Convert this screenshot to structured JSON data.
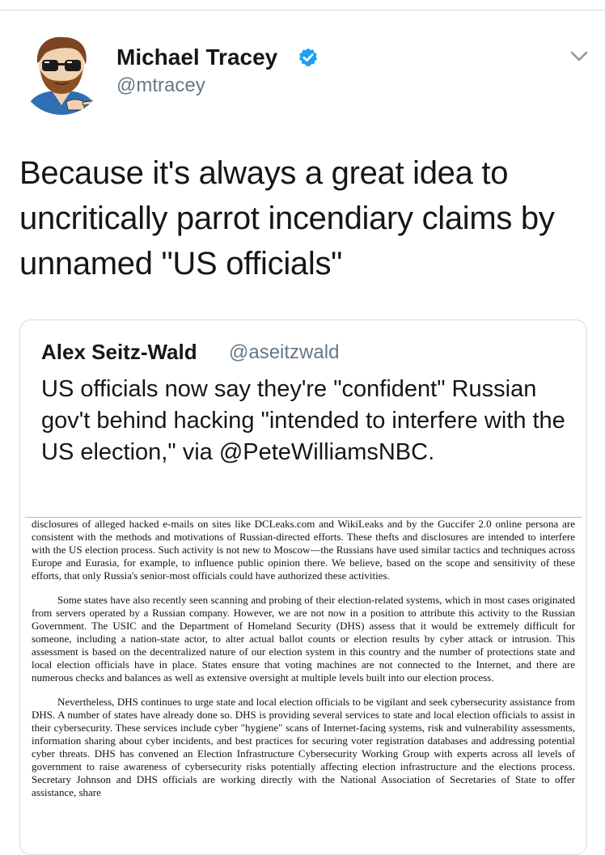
{
  "author": {
    "name": "Michael Tracey",
    "handle": "@mtracey",
    "avatar_icon": "cartoon-avatar-icon",
    "verified_icon": "verified-badge-icon"
  },
  "tweet": {
    "text": "Because it's always a great idea to uncritically parrot incendiary claims by unnamed \"US officials\""
  },
  "quoted": {
    "name": "Alex Seitz-Wald",
    "handle": "@aseitzwald",
    "text": "US officials now say they're \"confident\" Russian gov't behind hacking \"intended to interfere with the US election,\" via @PeteWilliamsNBC."
  },
  "document": {
    "paragraph1": "disclosures of alleged hacked e-mails on sites like DCLeaks.com and WikiLeaks and by the Guccifer 2.0 online persona are consistent with the methods and motivations of Russian-directed efforts. These thefts and disclosures are intended to interfere with the US election process. Such activity is not new to Moscow—the Russians have used similar tactics and techniques across Europe and Eurasia, for example, to influence public opinion there. We believe, based on the scope and sensitivity of these efforts, that only Russia's senior-most officials could have authorized these activities.",
    "paragraph2": "Some states have also recently seen scanning and probing of their election-related systems, which in most cases originated from servers operated by a Russian company. However, we are not now in a position to attribute this activity to the Russian Government. The USIC and the Department of Homeland Security (DHS) assess that it would be extremely difficult for someone, including a nation-state actor, to alter actual ballot counts or election results by cyber attack or intrusion. This assessment is based on the decentralized nature of our election system in this country and the number of protections state and local election officials have in place. States ensure that voting machines are not connected to the Internet, and there are numerous checks and balances as well as extensive oversight at multiple levels built into our election process.",
    "paragraph3": "Nevertheless, DHS continues to urge state and local election officials to be vigilant and seek cybersecurity assistance from DHS. A number of states have already done so. DHS is providing several services to state and local election officials to assist in their cybersecurity. These services include cyber \"hygiene\" scans of Internet-facing systems, risk and vulnerability assessments, information sharing about cyber incidents, and best practices for securing voter registration databases and addressing potential cyber threats. DHS has convened an Election Infrastructure Cybersecurity Working Group with experts across all levels of government to raise awareness of cybersecurity risks potentially affecting election infrastructure and the elections process. Secretary Johnson and DHS officials are working directly with the National Association of Secretaries of State to offer assistance, share"
  },
  "colors": {
    "verified_blue": "#1da1f2",
    "secondary_text": "#657786",
    "border": "#d6dbdf"
  }
}
